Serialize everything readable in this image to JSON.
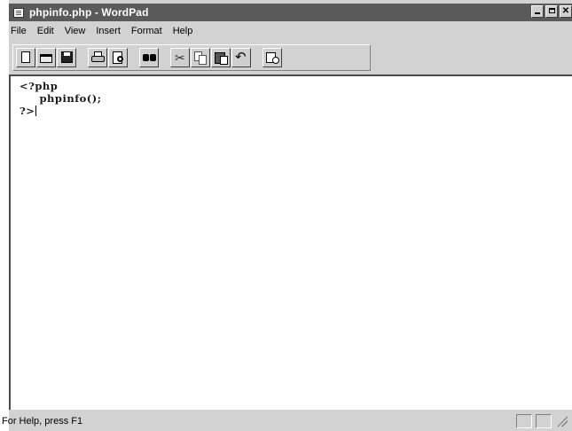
{
  "window": {
    "title": "phpinfo.php - WordPad"
  },
  "menu": [
    "File",
    "Edit",
    "View",
    "Insert",
    "Format",
    "Help"
  ],
  "toolbar": {
    "buttons": [
      "new-icon",
      "open-icon",
      "save-icon",
      "print-icon",
      "print-preview-icon",
      "find-icon",
      "cut-icon",
      "copy-icon",
      "paste-icon",
      "undo-icon",
      "date-time-icon"
    ]
  },
  "document": {
    "lines": [
      "<?php",
      "     phpinfo();",
      "?>"
    ]
  },
  "status": {
    "text": "For Help, press F1"
  },
  "colors": {
    "titlebar": "#5a5a5a",
    "chrome": "#d2d2d2",
    "editor_bg": "#ffffff"
  }
}
